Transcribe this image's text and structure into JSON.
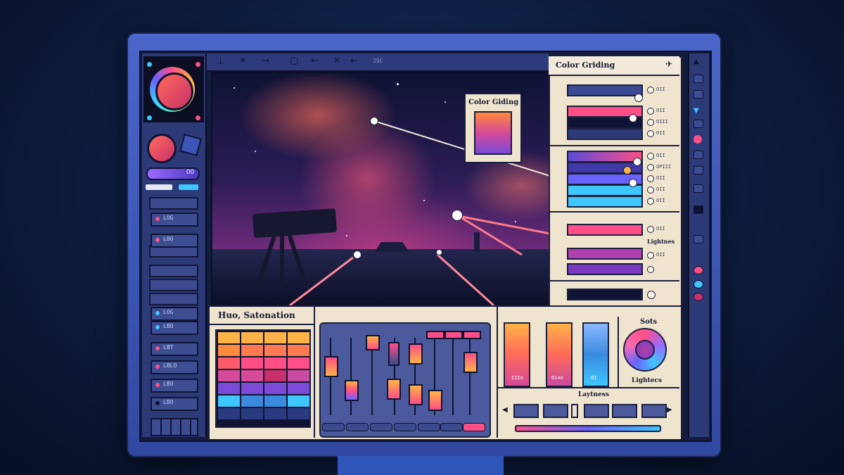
{
  "toolbar": {
    "items": [
      {
        "name": "crop-icon",
        "glyph": "⊥"
      },
      {
        "name": "link-icon",
        "glyph": "⚭"
      },
      {
        "name": "arrow-right-icon",
        "glyph": "→"
      },
      {
        "name": "frame-icon",
        "glyph": "▢"
      },
      {
        "name": "arrow-left-icon",
        "glyph": "←"
      },
      {
        "name": "close-icon",
        "glyph": "✕"
      },
      {
        "name": "back-icon",
        "glyph": "←"
      }
    ],
    "number": "35C"
  },
  "left_panel": {
    "buttons": [
      {
        "label": "LOG",
        "color": "#ff4f86"
      },
      {
        "label": "LBO",
        "color": "#ff4f86"
      },
      {
        "label": "LOG",
        "color": "#3ec6ff"
      },
      {
        "label": "LBO",
        "color": "#3ec6ff"
      },
      {
        "label": "LBT",
        "color": "#ff4f86"
      },
      {
        "label": "LBLO",
        "color": "#ff4f86"
      },
      {
        "label": "LBO",
        "color": "#ff4f86"
      },
      {
        "label": "LBO",
        "color": "#0f1434"
      }
    ],
    "pill_label": "OO"
  },
  "color_grading_panel": {
    "title": "Color Griding",
    "rows": [
      {
        "label": "OII"
      },
      {
        "label": "OII"
      },
      {
        "label": "OIII"
      },
      {
        "label": "OII"
      },
      {
        "label": "OII"
      },
      {
        "label": "OPIII"
      },
      {
        "label": "OII"
      },
      {
        "label": "OII"
      },
      {
        "label": "OII"
      },
      {
        "label": "OII"
      },
      {
        "label": "OII"
      }
    ],
    "lightness_label": "Lightnes"
  },
  "popup": {
    "title": "Color Giding"
  },
  "bottom": {
    "hue_sat_title": "Huo, Satonation",
    "swatch_labels": [
      "IIIo",
      "Oino",
      "OI"
    ],
    "sats_title": "Sots",
    "sats_sub": "Lightecs",
    "laytness_title": "Laytness"
  },
  "colors": {
    "accent_pink": "#ff4f86",
    "accent_blue": "#3ec6ff",
    "accent_purple": "#6a62ff",
    "panel_cream": "#efe5cf",
    "ui_navy": "#2c3a78"
  }
}
